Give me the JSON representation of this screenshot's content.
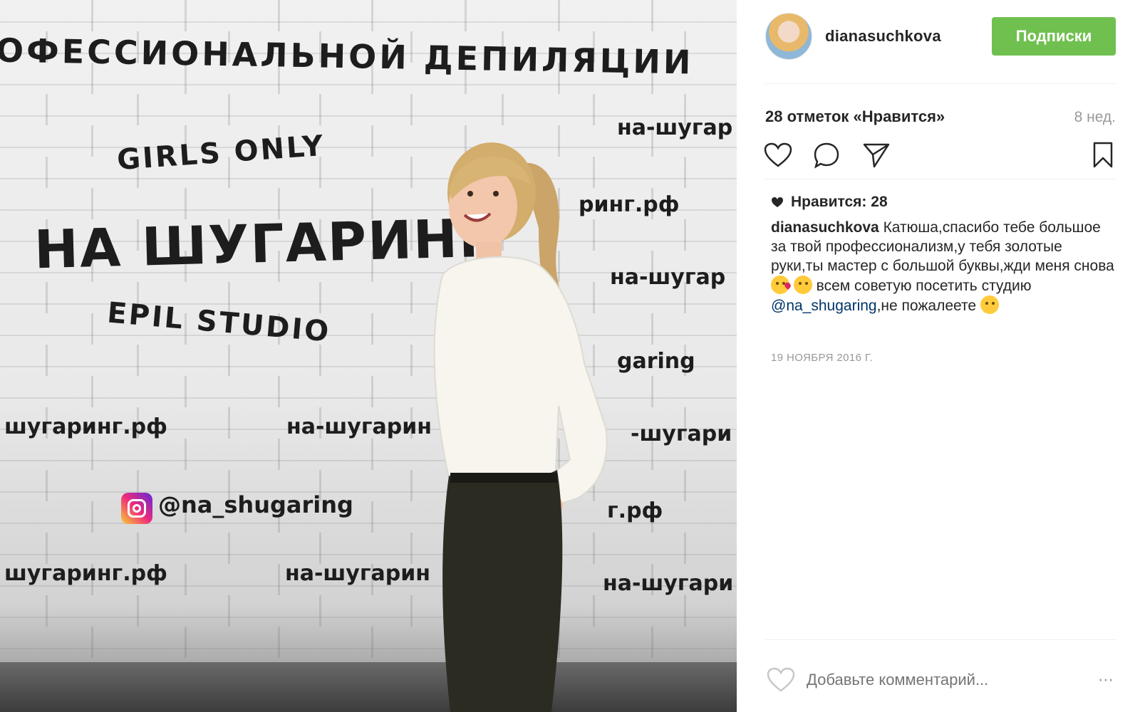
{
  "photo": {
    "wall_texts": {
      "professional": "ОФЕССИОНАЛЬНОЙ ДЕПИЛЯЦИИ",
      "girls_only": "GIRLS ONLY",
      "na_shugaring": "НА ШУГАРИНГ",
      "epil_studio": "EPIL STUDIO",
      "right_1": "на-шугар",
      "right_2": "ринг.рф",
      "right_3": "на-шугар",
      "right_4": "garing",
      "right_5": "-шугари",
      "right_6": "г.рф",
      "right_7": "на-шугари",
      "left_1": "шугаринг.рф",
      "left_2": "на-шугарин",
      "left_3": "шугаринг.рф",
      "left_4": "на-шугарин",
      "handle": "@na_shugaring"
    }
  },
  "post": {
    "username": "dianasuchkova",
    "follow_label": "Подписки",
    "likes_summary": "28 отметок «Нравится»",
    "time_ago": "8 нед.",
    "likes_small": "Нравится: 28",
    "caption": {
      "author": "dianasuchkova",
      "text_1": " Катюша,спасибо тебе большое за твой профессионализм,у тебя золотые руки,ты мастер с большой буквы,жди меня снова ",
      "text_2": "  всем советую посетить студию ",
      "mention": "@na_shugaring",
      "text_3": ",не пожалеете "
    },
    "date": "19 НОЯБРЯ 2016 Г.",
    "comment_placeholder": "Добавьте комментарий...",
    "more_label": "⋯"
  },
  "colors": {
    "follow_button": "#70c050",
    "mention": "#003569",
    "muted": "#999999"
  },
  "icons": [
    "heart-icon",
    "comment-icon",
    "share-icon",
    "bookmark-icon",
    "small-heart-icon",
    "instagram-logo-icon"
  ]
}
